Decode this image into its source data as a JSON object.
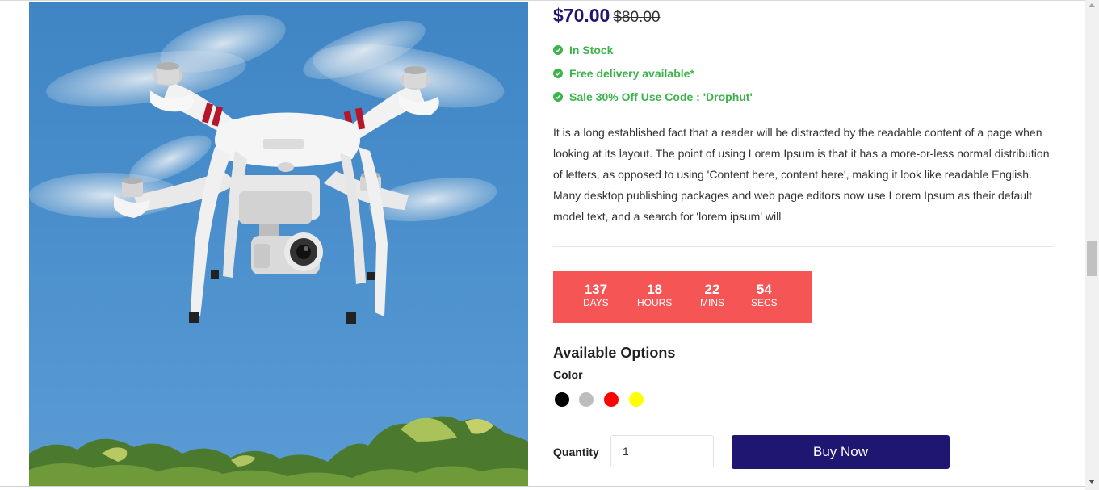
{
  "product": {
    "image_alt": "Quadcopter drone in flight",
    "price": "$70.00",
    "old_price": "$80.00",
    "features": [
      "In Stock",
      "Free delivery available*",
      "Sale 30% Off Use Code : 'Drophut'"
    ],
    "description": "It is a long established fact that a reader will be distracted by the readable content of a page when looking at its layout. The point of using Lorem Ipsum is that it has a more-or-less normal distribution of letters, as opposed to using 'Content here, content here', making it look like readable English. Many desktop publishing packages and web page editors now use Lorem Ipsum as their default model text, and a search for 'lorem ipsum' will"
  },
  "countdown": {
    "days": "137",
    "days_label": "DAYS",
    "hours": "18",
    "hours_label": "HOURS",
    "mins": "22",
    "mins_label": "MINS",
    "secs": "54",
    "secs_label": "SECS"
  },
  "options": {
    "title": "Available Options",
    "color_label": "Color",
    "colors": [
      "#000000",
      "#bdbdbd",
      "#ff0000",
      "#ffff00"
    ]
  },
  "purchase": {
    "quantity_label": "Quantity",
    "quantity_value": "1",
    "buy_label": "Buy Now"
  },
  "theme": {
    "price_color": "#1f1672",
    "feature_color": "#3cb44b",
    "countdown_bg": "#f55555",
    "button_bg": "#1f1672"
  }
}
